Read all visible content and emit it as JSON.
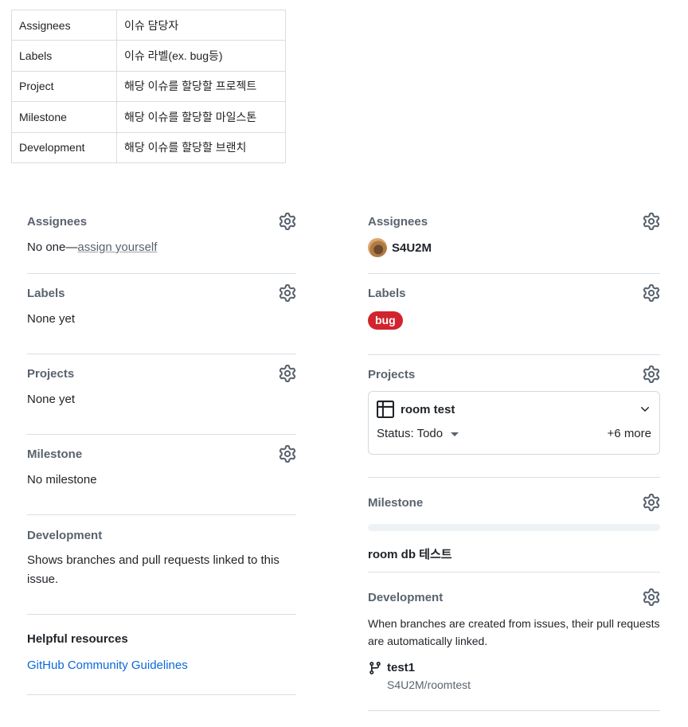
{
  "field_table": [
    {
      "key": "Assignees",
      "value": "이슈 담당자"
    },
    {
      "key": "Labels",
      "value": "이슈 라벨(ex. bug등)"
    },
    {
      "key": "Project",
      "value": "해당 이슈를 할당할 프로젝트"
    },
    {
      "key": "Milestone",
      "value": "해당 이슈를 할당할 마일스톤"
    },
    {
      "key": "Development",
      "value": "해당 이슈를 할당할 브랜치"
    }
  ],
  "left": {
    "assignees": {
      "title": "Assignees",
      "prefix": "No one—",
      "link": "assign yourself"
    },
    "labels": {
      "title": "Labels",
      "value": "None yet"
    },
    "projects": {
      "title": "Projects",
      "value": "None yet"
    },
    "milestone": {
      "title": "Milestone",
      "value": "No milestone"
    },
    "development": {
      "title": "Development",
      "value": "Shows branches and pull requests linked to this issue."
    },
    "helpful": {
      "title": "Helpful resources",
      "link": "GitHub Community Guidelines"
    }
  },
  "right": {
    "assignees": {
      "title": "Assignees",
      "user": "S4U2M"
    },
    "labels": {
      "title": "Labels",
      "label": "bug",
      "label_color": "#d1242f"
    },
    "projects": {
      "title": "Projects",
      "project_name": "room test",
      "status": "Status: Todo",
      "more": "+6 more"
    },
    "milestone": {
      "title": "Milestone",
      "progress": 0,
      "name": "room db 테스트"
    },
    "development": {
      "title": "Development",
      "text": "When branches are created from issues, their pull requests are automatically linked.",
      "branch": "test1",
      "repo": "S4U2M/roomtest"
    }
  },
  "icons": {
    "gear": "gear-icon",
    "table": "table-icon",
    "chevron": "chevron-down-icon",
    "branch": "git-branch-icon"
  },
  "colors": {
    "muted": "#59636e",
    "link": "#0969da",
    "border": "#d8dee4"
  }
}
